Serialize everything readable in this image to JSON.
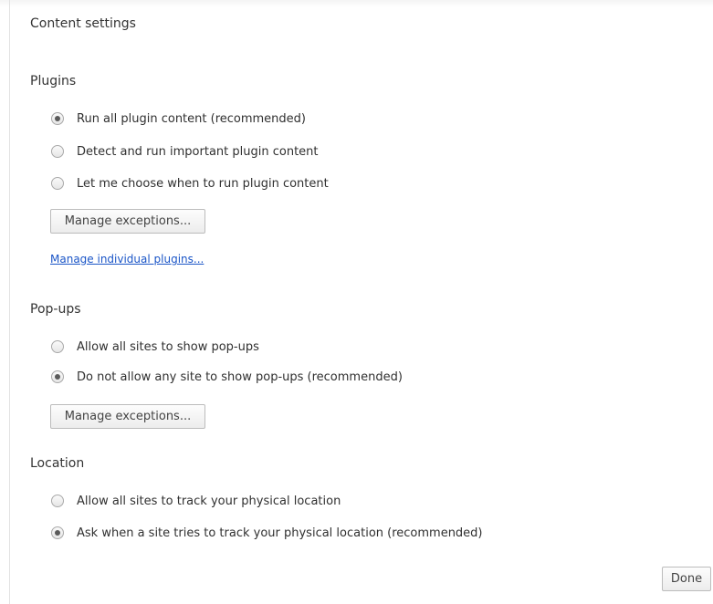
{
  "dialog": {
    "title": "Content settings",
    "done_label": "Done"
  },
  "plugins": {
    "title": "Plugins",
    "options": [
      {
        "label": "Run all plugin content (recommended)",
        "checked": true
      },
      {
        "label": "Detect and run important plugin content",
        "checked": false
      },
      {
        "label": "Let me choose when to run plugin content",
        "checked": false
      }
    ],
    "manage_exceptions_label": "Manage exceptions...",
    "manage_individual_link": "Manage individual plugins..."
  },
  "popups": {
    "title": "Pop-ups",
    "options": [
      {
        "label": "Allow all sites to show pop-ups",
        "checked": false
      },
      {
        "label": "Do not allow any site to show pop-ups (recommended)",
        "checked": true
      }
    ],
    "manage_exceptions_label": "Manage exceptions..."
  },
  "location": {
    "title": "Location",
    "options": [
      {
        "label": "Allow all sites to track your physical location",
        "checked": false
      },
      {
        "label": "Ask when a site tries to track your physical location (recommended)",
        "checked": true
      }
    ]
  }
}
